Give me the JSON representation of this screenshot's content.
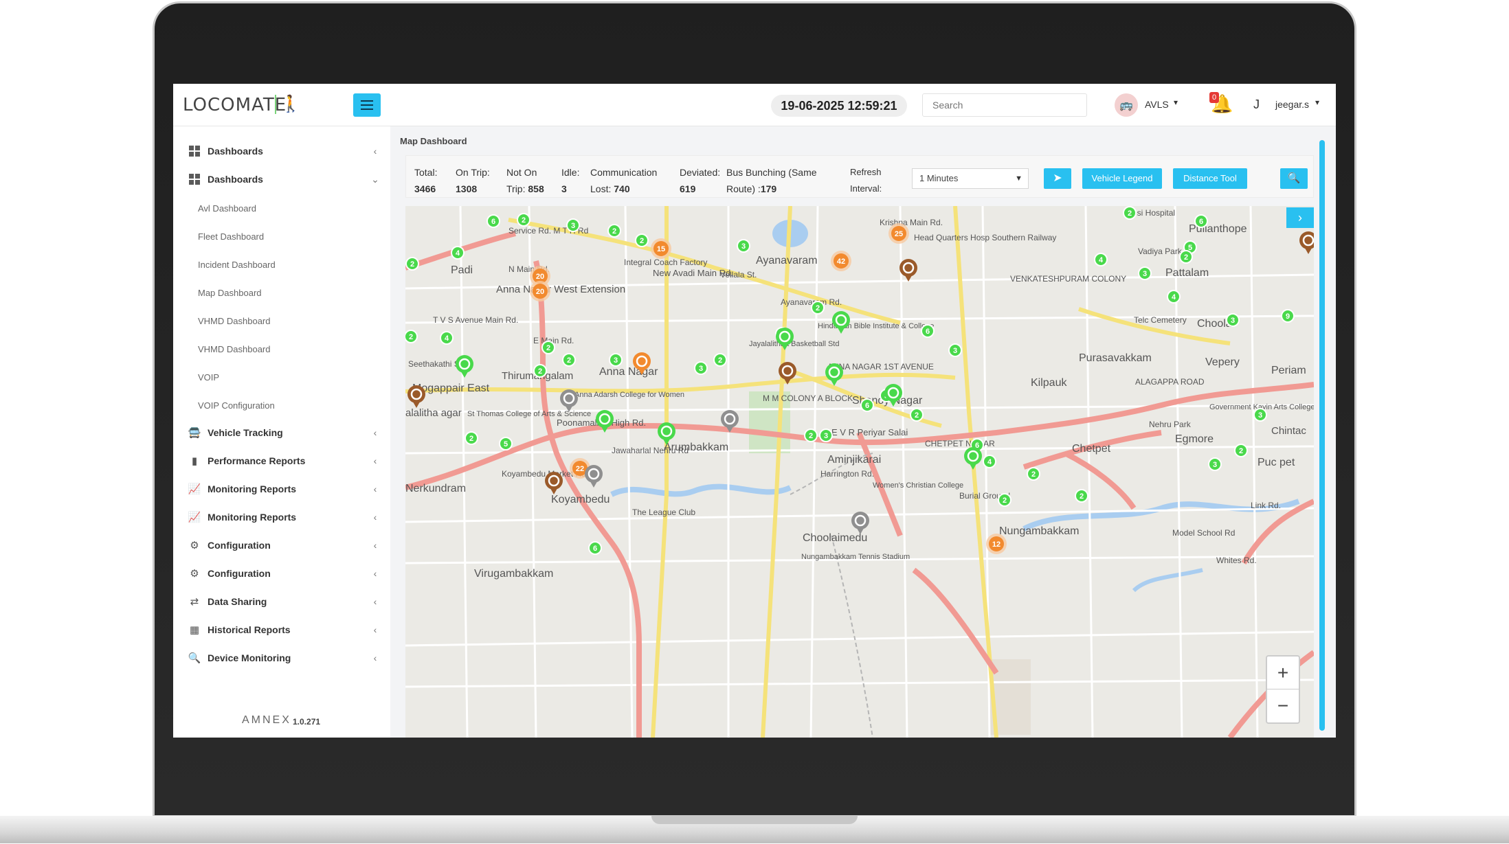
{
  "brand": {
    "name": "LOCOMATE",
    "footer_brand": "AMNEX",
    "version": "1.0.271"
  },
  "header": {
    "datetime": "19-06-2025 12:59:21",
    "search_placeholder": "Search",
    "user_group": "AVLS",
    "notification_count": "0",
    "user_initial": "J",
    "user_name": "jeegar.s"
  },
  "sidebar": {
    "items": [
      {
        "label": "Dashboards",
        "chev": "‹"
      },
      {
        "label": "Dashboards",
        "chev": "⌄"
      }
    ],
    "sub_items": [
      "Avl Dashboard",
      "Fleet Dashboard",
      "Incident Dashboard",
      "Map Dashboard",
      "VHMD Dashboard",
      "VHMD Dashboard",
      "VOIP",
      "VOIP Configuration"
    ],
    "lower_items": [
      "Vehicle Tracking",
      "Performance Reports",
      "Monitoring Reports",
      "Monitoring Reports",
      "Configuration",
      "Configuration",
      "Data Sharing",
      "Historical Reports",
      "Device Monitoring"
    ]
  },
  "main": {
    "page_title": "Map Dashboard",
    "stats": {
      "total_label": "Total:",
      "total_value": "3466",
      "ontrip_label": "On Trip:",
      "ontrip_value": "1308",
      "noton_label": "Not On",
      "noton_label2": "Trip:",
      "noton_value": "858",
      "idle_label": "Idle:",
      "idle_value": "3",
      "comm_label": "Communication",
      "comm_label2": "Lost:",
      "comm_value": "740",
      "dev_label": "Deviated:",
      "dev_value": "619",
      "bunch_label": "Bus Bunching (Same",
      "bunch_label2": "Route) :",
      "bunch_value": "179",
      "refresh_label": "Refresh",
      "refresh_label2": "Interval:"
    },
    "refresh_interval": "1 Minutes",
    "buttons": {
      "vehicle_legend": "Vehicle Legend",
      "distance_tool": "Distance Tool"
    },
    "zoom": {
      "in": "+",
      "out": "−"
    }
  },
  "map": {
    "places": [
      "Padi",
      "Anna Nagar West Extension",
      "Anna Nagar",
      "Thirumangalam",
      "Mogappair East",
      "Ayanavaram",
      "Pattalam",
      "Pulianthope",
      "Choolai",
      "Vepery",
      "Purasavakkam",
      "Kilpauk",
      "Shenoy Nagar",
      "Arumbakkam",
      "Aminjikarai",
      "Chetpet",
      "Egmore",
      "Koyambedu",
      "Nerkundram",
      "Nungambakkam",
      "Choolaimedu",
      "Virugambakkam",
      "Periam",
      "Puc pet",
      "Chintac",
      "Integral Coach Factory",
      "Head Quarters Hosp Southern Railway",
      "CHETPET NAGAR",
      "ANNA NAGAR 1ST AVENUE",
      "M M COLONY A BLOCK",
      "The League Club",
      "Burial Ground",
      "VENKATESHPURAM COLONY",
      "Telc Cemetery",
      "ALAGAPPA ROAD",
      "Vadiya Park",
      "Nehru Park",
      "Kesi Hospital",
      "St Thomas College of Arts & Science",
      "Anna Adarsh College for Women",
      "Jayalalithaa Basketball Std",
      "Hindustan Bible Institute & College",
      "Women's Christian College",
      "Government Kavin Arts College",
      "Nungambakkam Tennis Stadium",
      "Harrington Rd.",
      "Poonamallee High Rd.",
      "E V R Periyar Salai",
      "New Avadi Main Rd.",
      "Ayanavaram Rd.",
      "Krishna Main Rd.",
      "Service Rd. M T H Rd",
      "Seethakathi St.",
      "T V S Avenue Main Rd.",
      "N Main Rd.",
      "E Main Rd.",
      "Vellala St.",
      "Jawaharlal Nehru Rd",
      "Koyambedu Market Rd.",
      "Link Rd.",
      "Whites Rd.",
      "Model School Rd",
      "alalitha agar"
    ],
    "clusters_orange": [
      "20",
      "20",
      "15",
      "42",
      "25",
      "22",
      "12"
    ],
    "clusters_green": [
      "2",
      "6",
      "4",
      "2",
      "3",
      "2",
      "2",
      "5",
      "2",
      "6",
      "2",
      "3",
      "2",
      "2",
      "4",
      "2",
      "2",
      "3",
      "2",
      "3",
      "6",
      "3",
      "2",
      "6",
      "4",
      "2",
      "2",
      "2",
      "3",
      "2",
      "3",
      "3",
      "5",
      "6",
      "2",
      "2",
      "3",
      "4",
      "4",
      "3",
      "6",
      "2",
      "2",
      "3",
      "9"
    ],
    "colors": {
      "green": "#49d94b",
      "orange": "#f28a2e",
      "grey": "#8f8f8f",
      "brown": "#9a5a2a",
      "road_red": "#f19a93",
      "road_yellow": "#f5e27a",
      "water": "#a9cdf0",
      "park": "#cfe5c4",
      "accent": "#29c0f0"
    }
  }
}
